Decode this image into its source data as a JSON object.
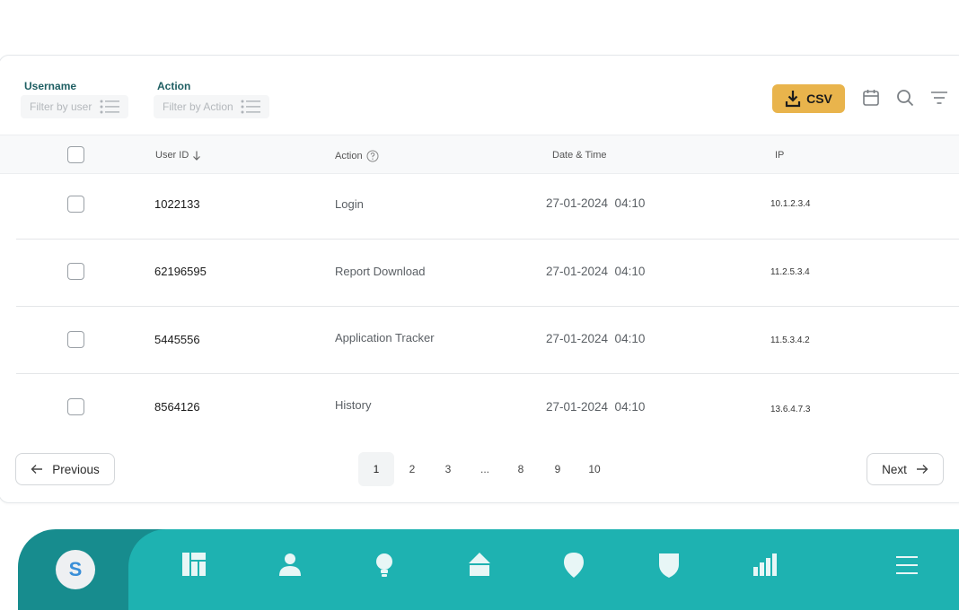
{
  "filters": {
    "username_label": "Username",
    "username_placeholder": "Filter by user",
    "action_label": "Action",
    "action_placeholder": "Filter by Action"
  },
  "toolbar": {
    "csv_label": "CSV"
  },
  "table": {
    "headers": {
      "user_id": "User ID",
      "action": "Action",
      "datetime": "Date & Time",
      "ip": "IP"
    },
    "rows": [
      {
        "user_id": "1022133",
        "action": "Login",
        "datetime": "27-01-2024  04:10",
        "ip": "10.1.2.3.4"
      },
      {
        "user_id": "62196595",
        "action": "Report Download",
        "datetime": "27-01-2024  04:10",
        "ip": "11.2.5.3.4"
      },
      {
        "user_id": "5445556",
        "action": "Application Tracker",
        "datetime": "27-01-2024  04:10",
        "ip": "11.5.3.4.2"
      },
      {
        "user_id": "8564126",
        "action": "History",
        "datetime": "27-01-2024  04:10",
        "ip": "13.6.4.7.3"
      }
    ]
  },
  "pagination": {
    "previous_label": "Previous",
    "next_label": "Next",
    "pages": [
      "1",
      "2",
      "3",
      "...",
      "8",
      "9",
      "10"
    ],
    "current_page": "1"
  },
  "nav": {
    "avatar_initial": "S"
  },
  "colors": {
    "accent": "#e9b44c",
    "nav_teal": "#1eb2b1",
    "nav_dark": "#178c8e",
    "label": "#1f5f63"
  }
}
